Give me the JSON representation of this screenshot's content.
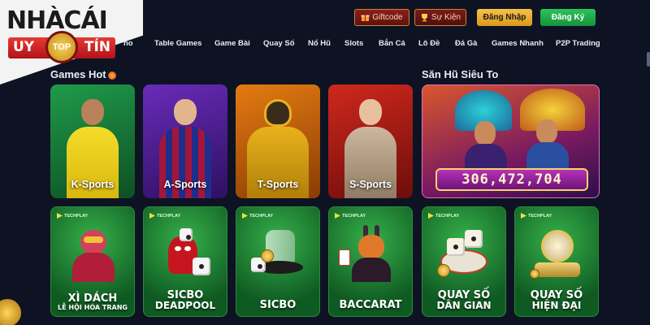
{
  "logo": {
    "title": "NHÀCÁI",
    "ribbon_left": "UY",
    "ribbon_center": "TOP",
    "ribbon_right": "TÍN"
  },
  "topbar": {
    "giftcode_label": "Giftcode",
    "events_label": "Sự Kiện",
    "login_label": "Đăng Nhập",
    "register_label": "Đăng Ký"
  },
  "nav": {
    "items": [
      {
        "label": "no"
      },
      {
        "label": "Table Games"
      },
      {
        "label": "Game Bài"
      },
      {
        "label": "Quay Số"
      },
      {
        "label": "Nổ Hũ"
      },
      {
        "label": "Slots"
      },
      {
        "label": "Bắn Cá"
      },
      {
        "label": "Lô Đề"
      },
      {
        "label": "Đá Gà"
      },
      {
        "label": "Games Nhanh"
      },
      {
        "label": "P2P Trading"
      }
    ]
  },
  "sections": {
    "hot_title": "Games Hot",
    "jackpot_title": "Săn Hũ Siêu To"
  },
  "sports": [
    {
      "label": "K-Sports",
      "jersey": "#f2d81f",
      "skin": "#b9825a"
    },
    {
      "label": "A-Sports",
      "jersey": "#a3163a",
      "skin": "#e3b58f"
    },
    {
      "label": "T-Sports",
      "jersey": "#e8b21d",
      "skin": "#6b4127"
    },
    {
      "label": "S-Sports",
      "jersey": "#c9b69c",
      "skin": "#e8c0a0"
    }
  ],
  "jackpot": {
    "amount": "306,472,704"
  },
  "games": {
    "brand": "TECHPLAY",
    "items": [
      {
        "line1": "XÌ DÁCH",
        "line2": "LỄ HỘI HÓA TRANG"
      },
      {
        "line1": "SICBO",
        "line2": "DEADPOOL"
      },
      {
        "line1": "SICBO",
        "line2": ""
      },
      {
        "line1": "BACCARAT",
        "line2": ""
      },
      {
        "line1": "QUAY SỐ",
        "line2": "DÂN GIAN"
      },
      {
        "line1": "QUAY SỐ",
        "line2": "HIỆN ĐẠI"
      }
    ]
  },
  "colors": {
    "background": "#0d1322",
    "login": "#f0b832",
    "register": "#1fb04a",
    "game_card": "#1f8a36",
    "brand_red": "#d8202a"
  }
}
